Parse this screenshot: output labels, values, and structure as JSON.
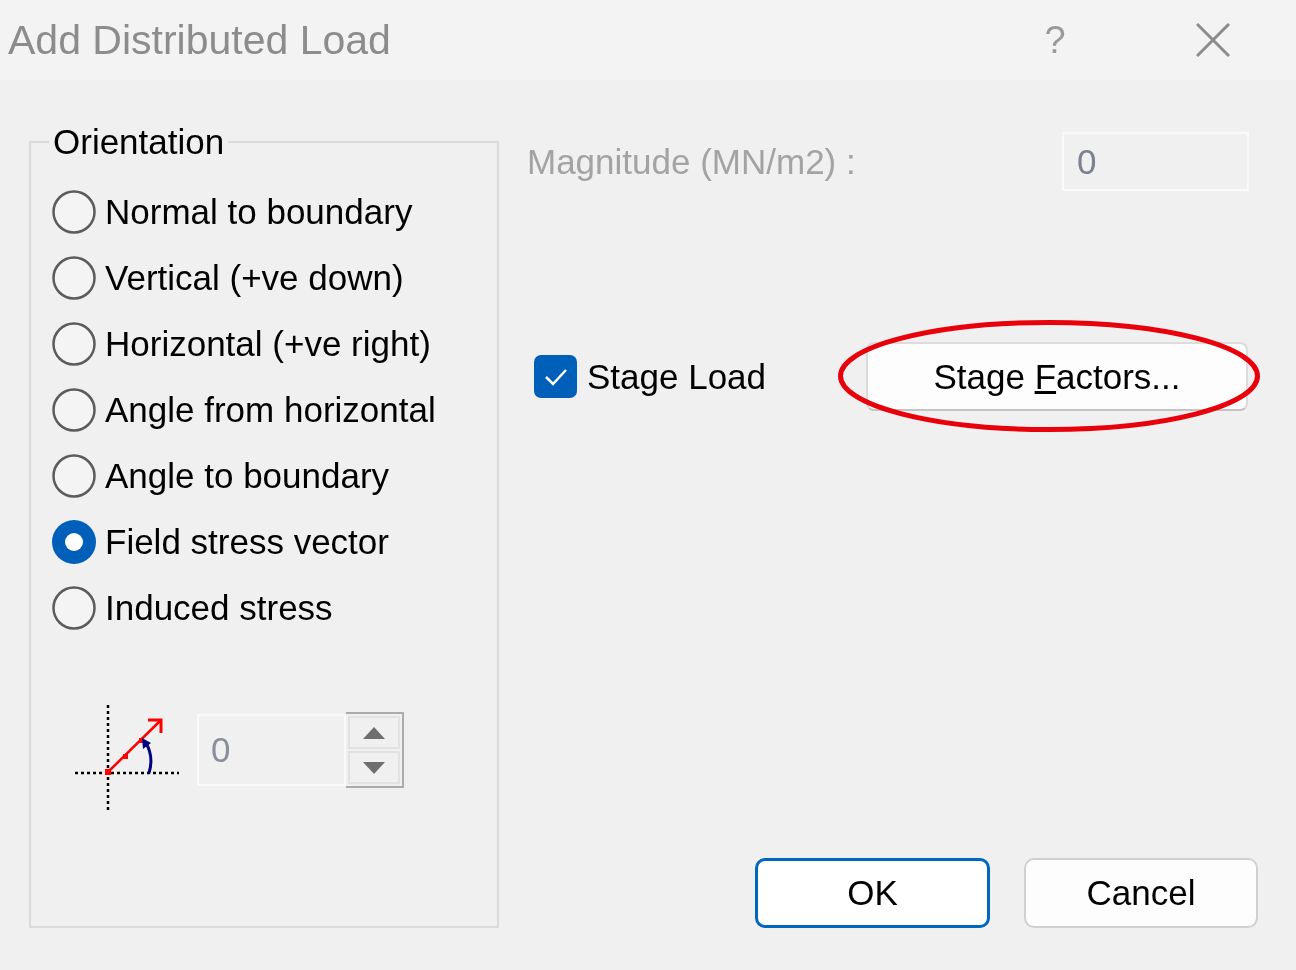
{
  "window": {
    "title": "Add Distributed Load",
    "help": "?"
  },
  "orientation": {
    "title": "Orientation",
    "options": [
      {
        "label": "Normal to boundary",
        "selected": false
      },
      {
        "label": "Vertical (+ve down)",
        "selected": false
      },
      {
        "label": "Horizontal (+ve right)",
        "selected": false
      },
      {
        "label": "Angle from horizontal",
        "selected": false
      },
      {
        "label": "Angle to boundary",
        "selected": false
      },
      {
        "label": "Field stress vector",
        "selected": true
      },
      {
        "label": "Induced stress",
        "selected": false
      }
    ],
    "angle": {
      "value": "0",
      "disabled": true
    }
  },
  "magnitude": {
    "label": "Magnitude (MN/m2) :",
    "value": "0",
    "disabled": true
  },
  "stage_load": {
    "label": "Stage Load",
    "checked": true
  },
  "stage_factors_button": {
    "label_parts": [
      {
        "text": "Stage ",
        "underline": false
      },
      {
        "text": "F",
        "underline": true
      },
      {
        "text": "actors...",
        "underline": false
      }
    ],
    "highlighted": true
  },
  "buttons": [
    {
      "label": "OK",
      "default": true
    },
    {
      "label": "Cancel",
      "default": false
    }
  ]
}
